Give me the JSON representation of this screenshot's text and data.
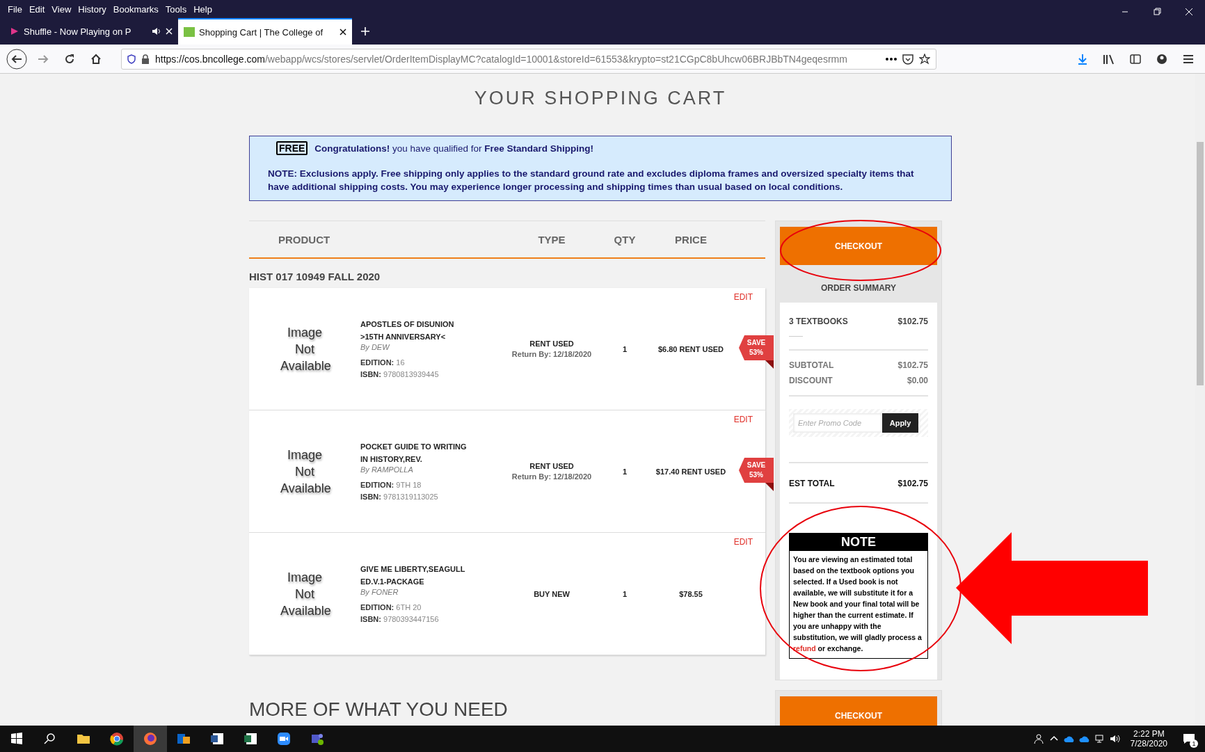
{
  "browser": {
    "menu": [
      "File",
      "Edit",
      "View",
      "History",
      "Bookmarks",
      "Tools",
      "Help"
    ],
    "tabs": [
      {
        "title": "Shuffle - Now Playing on P",
        "selected": false,
        "audio": true
      },
      {
        "title": "Shopping Cart | The College of",
        "selected": true,
        "audio": false
      }
    ],
    "url": {
      "host": "https://cos.bncollege.com",
      "path": "/webapp/wcs/stores/servlet/OrderItemDisplayMC?catalogId=10001&storeId=61553&krypto=st21CGpC8bUhcw06BRJBbTN4geqesrmm"
    }
  },
  "page": {
    "title": "YOUR SHOPPING CART",
    "banner": {
      "icon_text": "FREE",
      "message": "**Congratulations!** you have qualified for **Free Standard Shipping!**",
      "note": "NOTE: Exclusions apply. Free shipping only applies to the standard ground rate and excludes diploma frames and oversized specialty items that have additional shipping costs. You may experience longer processing and shipping times than usual based on local conditions."
    },
    "table": {
      "columns": [
        "PRODUCT",
        "TYPE",
        "QTY",
        "PRICE"
      ],
      "group": {
        "course": "HIST 017 10949",
        "term": "FALL 2020"
      },
      "rows": [
        {
          "edit": "EDIT",
          "image_text": "Image Not Available",
          "title": "APOSTLES OF DISUNION >15TH ANNIVERSARY<",
          "author": "By DEW",
          "edition_label": "EDITION:",
          "edition": "16",
          "isbn_label": "ISBN:",
          "isbn": "9780813939445",
          "type": "RENT USED",
          "return_by": "Return By: 12/18/2020",
          "qty": "1",
          "price": "$6.80 RENT USED",
          "save": [
            "SAVE",
            "53%"
          ]
        },
        {
          "edit": "EDIT",
          "image_text": "Image Not Available",
          "title": "POCKET GUIDE TO WRITING IN HISTORY,REV.",
          "author": "By RAMPOLLA",
          "edition_label": "EDITION:",
          "edition": "9TH 18",
          "isbn_label": "ISBN:",
          "isbn": "9781319113025",
          "type": "RENT USED",
          "return_by": "Return By: 12/18/2020",
          "qty": "1",
          "price": "$17.40 RENT USED",
          "save": [
            "SAVE",
            "53%"
          ]
        },
        {
          "edit": "EDIT",
          "image_text": "Image Not Available",
          "title": "GIVE ME LIBERTY,SEAGULL ED.V.1-PACKAGE",
          "author": "By FONER",
          "edition_label": "EDITION:",
          "edition": "6TH 20",
          "isbn_label": "ISBN:",
          "isbn": "9780393447156",
          "type": "BUY NEW",
          "qty": "1",
          "price": "$78.55"
        }
      ]
    },
    "summary": {
      "checkout": "CHECKOUT",
      "heading": "ORDER SUMMARY",
      "lines": [
        {
          "label": "3 TEXTBOOKS",
          "value": "$102.75",
          "kind": "items"
        },
        {
          "label": "SUBTOTAL",
          "value": "$102.75",
          "kind": "muted"
        },
        {
          "label": "DISCOUNT",
          "value": "$0.00",
          "kind": "muted"
        }
      ],
      "promo": {
        "placeholder": "Enter Promo Code",
        "button": "Apply"
      },
      "total": {
        "label": "EST TOTAL",
        "value": "$102.75"
      },
      "note": {
        "heading": "NOTE",
        "text": "You are viewing an estimated total based on the textbook options you selected. If a Used book is not available, we will substitute it for a New book and your final total will be higher than the current estimate. If you are unhappy with the substitution, we will gladly process a",
        "link": "refund",
        "tail": "or exchange."
      },
      "checkout_bottom": "CHECKOUT"
    },
    "more_heading": "MORE OF WHAT YOU NEED"
  },
  "taskbar": {
    "time": "2:22 PM",
    "date": "7/28/2020",
    "notifications": "1"
  }
}
